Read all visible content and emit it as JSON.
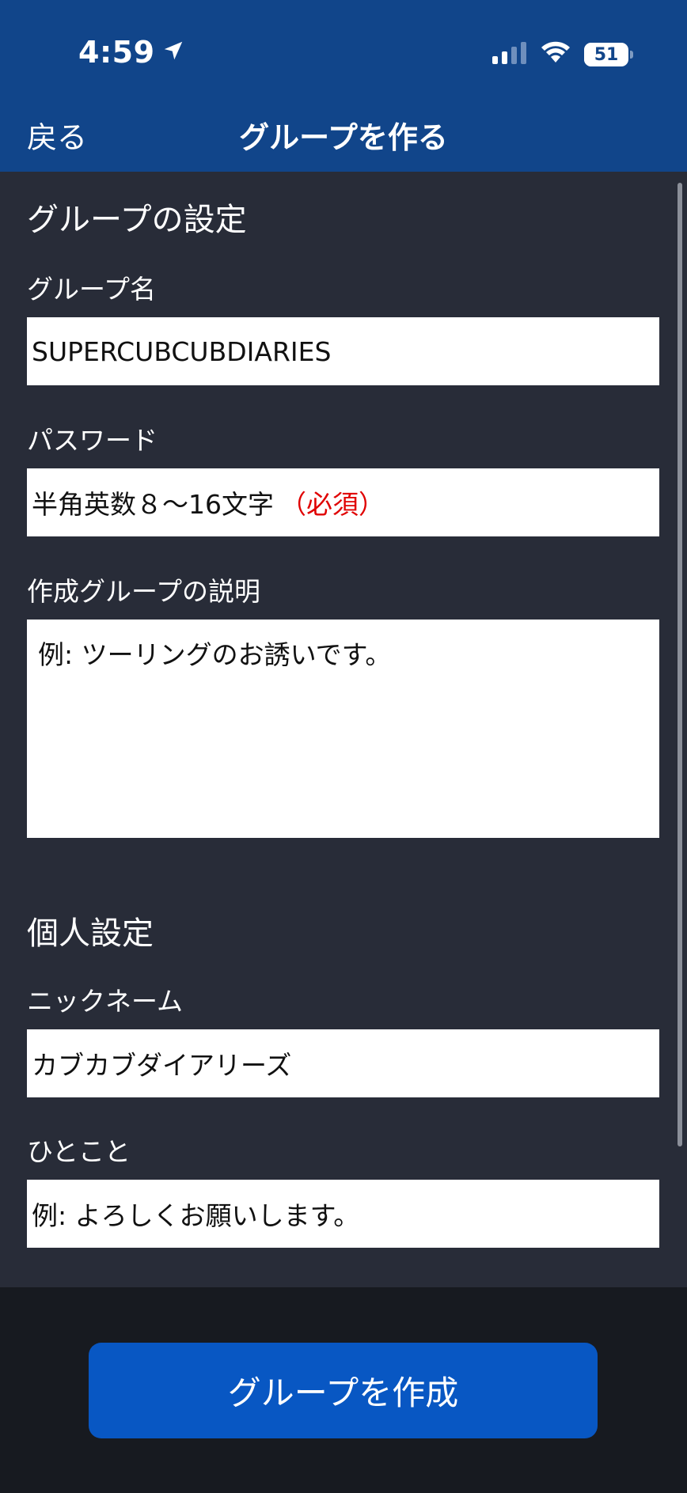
{
  "status_bar": {
    "time": "4:59",
    "battery": "51",
    "battery_level": 0.51
  },
  "nav": {
    "back_label": "戻る",
    "title": "グループを作る"
  },
  "group_settings": {
    "section_title": "グループの設定",
    "group_name_label": "グループ名",
    "group_name_value": "SUPERCUBCUBDIARIES",
    "password_label": "パスワード",
    "password_placeholder": "半角英数８〜16文字",
    "password_required": "（必須）",
    "description_label": "作成グループの説明",
    "description_placeholder": "例: ツーリングのお誘いです。"
  },
  "personal_settings": {
    "section_title": "個人設定",
    "nickname_label": "ニックネーム",
    "nickname_value": "カブカブダイアリーズ",
    "comment_label": "ひとこと",
    "comment_placeholder": "例: よろしくお願いします。"
  },
  "footer": {
    "create_button_label": "グループを作成"
  },
  "colors": {
    "header_bg": "#11458a",
    "content_bg": "#282c38",
    "footer_bg": "#171a20",
    "button_bg": "#0857c3",
    "required_text": "#e00000"
  },
  "icons": [
    "location-arrow-icon",
    "cellular-signal-icon",
    "wifi-icon",
    "battery-icon"
  ]
}
